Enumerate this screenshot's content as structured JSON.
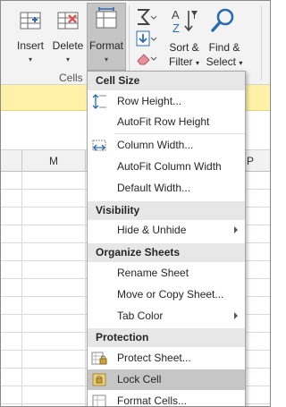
{
  "ribbon": {
    "insert_label": "Insert",
    "delete_label": "Delete",
    "format_label": "Format",
    "cells_group_label": "Cells",
    "sort_filter_line1": "Sort &",
    "sort_filter_line2": "Filter",
    "find_select_line1": "Find &",
    "find_select_line2": "Select",
    "dropdown_glyph": "▾"
  },
  "grid": {
    "column_m": "M",
    "column_p": "P"
  },
  "menu": {
    "cell_size_header": "Cell Size",
    "row_height": "Row Height...",
    "autofit_row_height": "AutoFit Row Height",
    "column_width": "Column Width...",
    "autofit_column_width": "AutoFit Column Width",
    "default_width": "Default Width...",
    "visibility_header": "Visibility",
    "hide_unhide": "Hide & Unhide",
    "organize_sheets_header": "Organize Sheets",
    "rename_sheet": "Rename Sheet",
    "move_copy_sheet": "Move or Copy Sheet...",
    "tab_color": "Tab Color",
    "protection_header": "Protection",
    "protect_sheet": "Protect Sheet...",
    "lock_cell": "Lock Cell",
    "format_cells": "Format Cells..."
  },
  "colors": {
    "accent_blue": "#2b6cb0",
    "delete_red": "#d9534f",
    "info_bar_yellow": "#fff2a8",
    "hover_gray": "#c6c6c6",
    "section_gray": "#e7e7e7"
  }
}
